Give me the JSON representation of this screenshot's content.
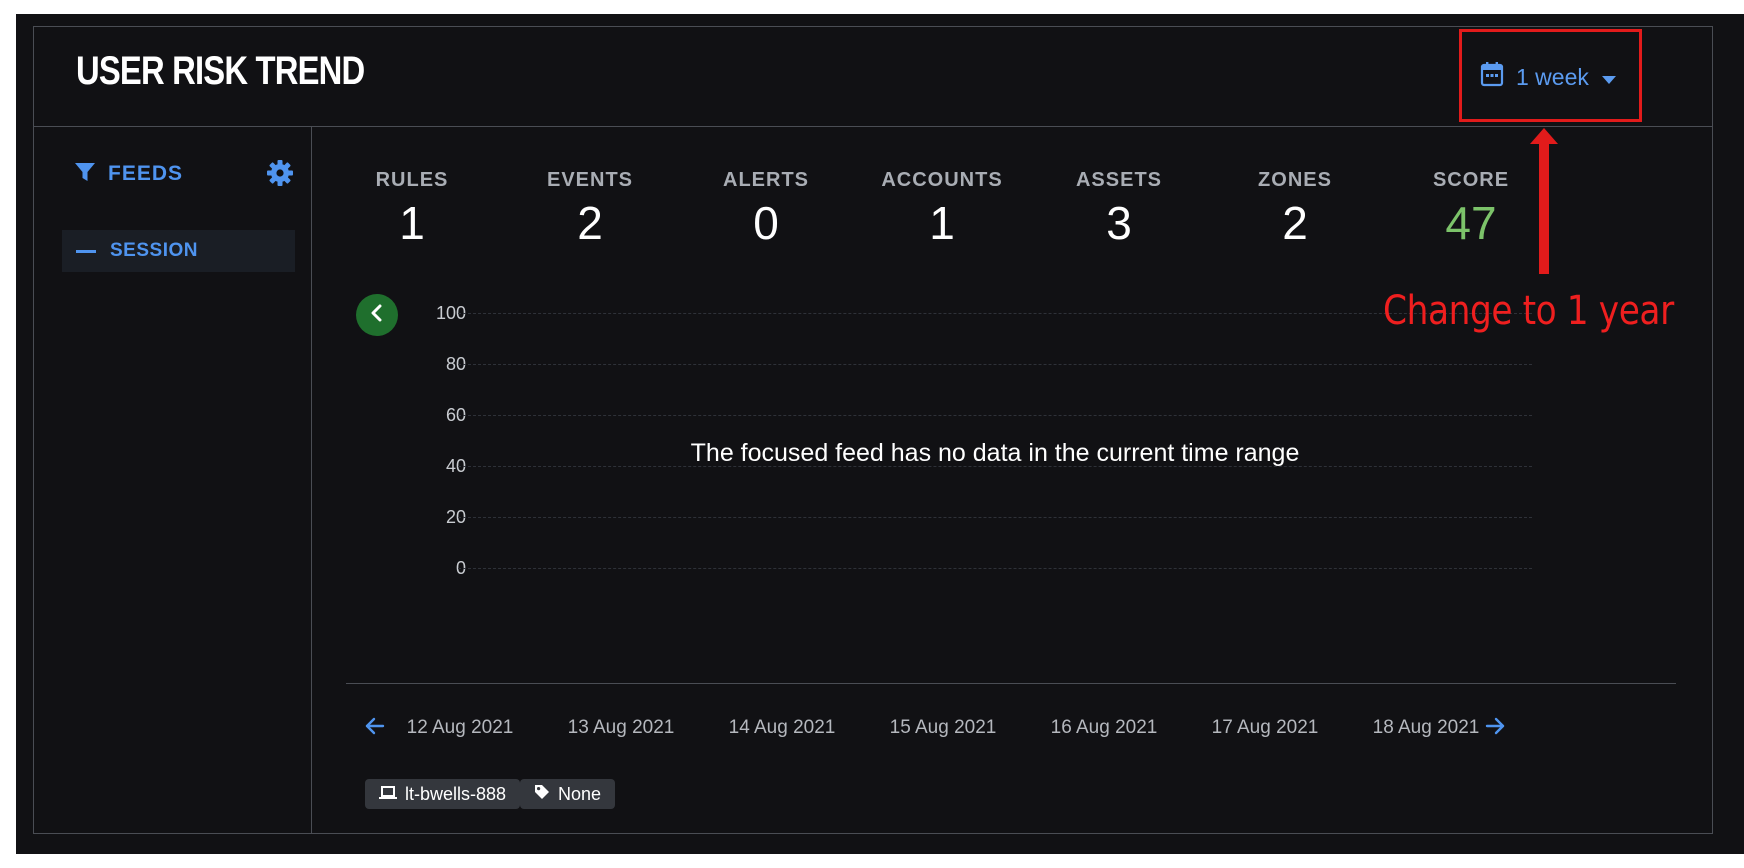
{
  "title": "USER RISK TREND",
  "time_range": {
    "label": "1 week"
  },
  "sidebar": {
    "feeds_label": "FEEDS",
    "items": [
      {
        "label": "SESSION"
      }
    ]
  },
  "stats": [
    {
      "label": "RULES",
      "value": "1"
    },
    {
      "label": "EVENTS",
      "value": "2"
    },
    {
      "label": "ALERTS",
      "value": "0"
    },
    {
      "label": "ACCOUNTS",
      "value": "1"
    },
    {
      "label": "ASSETS",
      "value": "3"
    },
    {
      "label": "ZONES",
      "value": "2"
    },
    {
      "label": "SCORE",
      "value": "47"
    }
  ],
  "chart_data": {
    "type": "line",
    "y_ticks": [
      "100",
      "80",
      "60",
      "40",
      "20",
      "0"
    ],
    "ylim": [
      0,
      100
    ],
    "x": [
      "12 Aug 2021",
      "13 Aug 2021",
      "14 Aug 2021",
      "15 Aug 2021",
      "16 Aug 2021",
      "17 Aug 2021",
      "18 Aug 2021"
    ],
    "series": [],
    "message": "The focused feed has no data in the current time range",
    "grid": true
  },
  "chips": [
    {
      "icon": "laptop-icon",
      "label": "lt-bwells-888"
    },
    {
      "icon": "tag-icon",
      "label": "None"
    }
  ],
  "annotation": {
    "text": "Change to 1 year",
    "color": "#e21b1b"
  },
  "colors": {
    "accent": "#4f94ef",
    "score": "#7cc36a",
    "background": "#111114"
  }
}
